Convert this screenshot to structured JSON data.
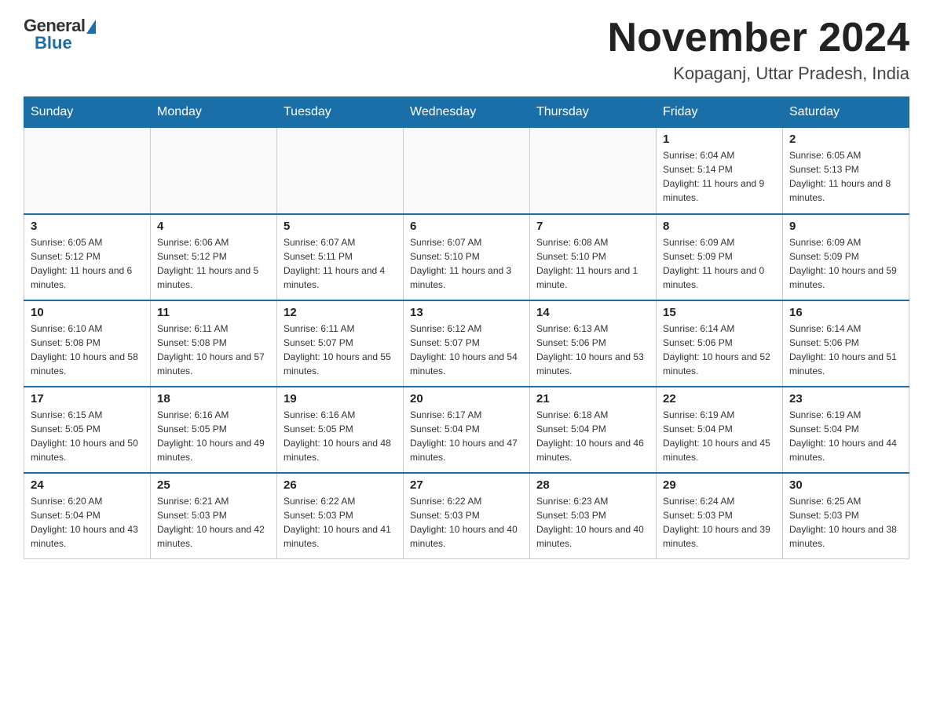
{
  "header": {
    "logo_general": "General",
    "logo_blue": "Blue",
    "title": "November 2024",
    "subtitle": "Kopaganj, Uttar Pradesh, India"
  },
  "weekdays": [
    "Sunday",
    "Monday",
    "Tuesday",
    "Wednesday",
    "Thursday",
    "Friday",
    "Saturday"
  ],
  "weeks": [
    [
      {
        "day": "",
        "info": ""
      },
      {
        "day": "",
        "info": ""
      },
      {
        "day": "",
        "info": ""
      },
      {
        "day": "",
        "info": ""
      },
      {
        "day": "",
        "info": ""
      },
      {
        "day": "1",
        "info": "Sunrise: 6:04 AM\nSunset: 5:14 PM\nDaylight: 11 hours and 9 minutes."
      },
      {
        "day": "2",
        "info": "Sunrise: 6:05 AM\nSunset: 5:13 PM\nDaylight: 11 hours and 8 minutes."
      }
    ],
    [
      {
        "day": "3",
        "info": "Sunrise: 6:05 AM\nSunset: 5:12 PM\nDaylight: 11 hours and 6 minutes."
      },
      {
        "day": "4",
        "info": "Sunrise: 6:06 AM\nSunset: 5:12 PM\nDaylight: 11 hours and 5 minutes."
      },
      {
        "day": "5",
        "info": "Sunrise: 6:07 AM\nSunset: 5:11 PM\nDaylight: 11 hours and 4 minutes."
      },
      {
        "day": "6",
        "info": "Sunrise: 6:07 AM\nSunset: 5:10 PM\nDaylight: 11 hours and 3 minutes."
      },
      {
        "day": "7",
        "info": "Sunrise: 6:08 AM\nSunset: 5:10 PM\nDaylight: 11 hours and 1 minute."
      },
      {
        "day": "8",
        "info": "Sunrise: 6:09 AM\nSunset: 5:09 PM\nDaylight: 11 hours and 0 minutes."
      },
      {
        "day": "9",
        "info": "Sunrise: 6:09 AM\nSunset: 5:09 PM\nDaylight: 10 hours and 59 minutes."
      }
    ],
    [
      {
        "day": "10",
        "info": "Sunrise: 6:10 AM\nSunset: 5:08 PM\nDaylight: 10 hours and 58 minutes."
      },
      {
        "day": "11",
        "info": "Sunrise: 6:11 AM\nSunset: 5:08 PM\nDaylight: 10 hours and 57 minutes."
      },
      {
        "day": "12",
        "info": "Sunrise: 6:11 AM\nSunset: 5:07 PM\nDaylight: 10 hours and 55 minutes."
      },
      {
        "day": "13",
        "info": "Sunrise: 6:12 AM\nSunset: 5:07 PM\nDaylight: 10 hours and 54 minutes."
      },
      {
        "day": "14",
        "info": "Sunrise: 6:13 AM\nSunset: 5:06 PM\nDaylight: 10 hours and 53 minutes."
      },
      {
        "day": "15",
        "info": "Sunrise: 6:14 AM\nSunset: 5:06 PM\nDaylight: 10 hours and 52 minutes."
      },
      {
        "day": "16",
        "info": "Sunrise: 6:14 AM\nSunset: 5:06 PM\nDaylight: 10 hours and 51 minutes."
      }
    ],
    [
      {
        "day": "17",
        "info": "Sunrise: 6:15 AM\nSunset: 5:05 PM\nDaylight: 10 hours and 50 minutes."
      },
      {
        "day": "18",
        "info": "Sunrise: 6:16 AM\nSunset: 5:05 PM\nDaylight: 10 hours and 49 minutes."
      },
      {
        "day": "19",
        "info": "Sunrise: 6:16 AM\nSunset: 5:05 PM\nDaylight: 10 hours and 48 minutes."
      },
      {
        "day": "20",
        "info": "Sunrise: 6:17 AM\nSunset: 5:04 PM\nDaylight: 10 hours and 47 minutes."
      },
      {
        "day": "21",
        "info": "Sunrise: 6:18 AM\nSunset: 5:04 PM\nDaylight: 10 hours and 46 minutes."
      },
      {
        "day": "22",
        "info": "Sunrise: 6:19 AM\nSunset: 5:04 PM\nDaylight: 10 hours and 45 minutes."
      },
      {
        "day": "23",
        "info": "Sunrise: 6:19 AM\nSunset: 5:04 PM\nDaylight: 10 hours and 44 minutes."
      }
    ],
    [
      {
        "day": "24",
        "info": "Sunrise: 6:20 AM\nSunset: 5:04 PM\nDaylight: 10 hours and 43 minutes."
      },
      {
        "day": "25",
        "info": "Sunrise: 6:21 AM\nSunset: 5:03 PM\nDaylight: 10 hours and 42 minutes."
      },
      {
        "day": "26",
        "info": "Sunrise: 6:22 AM\nSunset: 5:03 PM\nDaylight: 10 hours and 41 minutes."
      },
      {
        "day": "27",
        "info": "Sunrise: 6:22 AM\nSunset: 5:03 PM\nDaylight: 10 hours and 40 minutes."
      },
      {
        "day": "28",
        "info": "Sunrise: 6:23 AM\nSunset: 5:03 PM\nDaylight: 10 hours and 40 minutes."
      },
      {
        "day": "29",
        "info": "Sunrise: 6:24 AM\nSunset: 5:03 PM\nDaylight: 10 hours and 39 minutes."
      },
      {
        "day": "30",
        "info": "Sunrise: 6:25 AM\nSunset: 5:03 PM\nDaylight: 10 hours and 38 minutes."
      }
    ]
  ]
}
